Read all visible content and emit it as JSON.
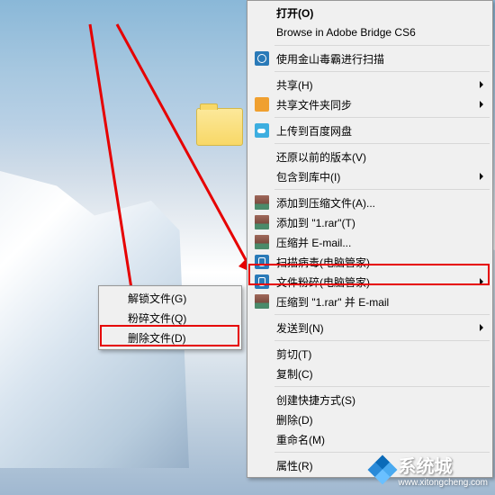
{
  "left_menu": {
    "items": [
      {
        "label": "解锁文件(G)"
      },
      {
        "label": "粉碎文件(Q)"
      },
      {
        "label": "删除文件(D)"
      }
    ]
  },
  "right_menu": {
    "groups": [
      [
        {
          "label": "打开(O)",
          "bold": true
        },
        {
          "label": "Browse in Adobe Bridge CS6"
        }
      ],
      [
        {
          "label": "使用金山毒霸进行扫描",
          "icon": "blue"
        }
      ],
      [
        {
          "label": "共享(H)",
          "arrow": true
        },
        {
          "label": "共享文件夹同步",
          "icon": "orange",
          "arrow": true
        }
      ],
      [
        {
          "label": "上传到百度网盘",
          "icon": "cloud"
        }
      ],
      [
        {
          "label": "还原以前的版本(V)"
        },
        {
          "label": "包含到库中(I)",
          "arrow": true
        }
      ],
      [
        {
          "label": "添加到压缩文件(A)...",
          "icon": "rar"
        },
        {
          "label": "添加到 \"1.rar\"(T)",
          "icon": "rar"
        },
        {
          "label": "压缩并 E-mail...",
          "icon": "rar"
        },
        {
          "label": "扫描病毒(电脑管家)",
          "icon": "tc"
        },
        {
          "label": "文件粉碎(电脑管家)",
          "icon": "tc",
          "arrow": true
        },
        {
          "label": "压缩到 \"1.rar\" 并 E-mail",
          "icon": "rar"
        }
      ],
      [
        {
          "label": "发送到(N)",
          "arrow": true
        }
      ],
      [
        {
          "label": "剪切(T)"
        },
        {
          "label": "复制(C)"
        }
      ],
      [
        {
          "label": "创建快捷方式(S)"
        },
        {
          "label": "删除(D)"
        },
        {
          "label": "重命名(M)"
        }
      ],
      [
        {
          "label": "属性(R)"
        }
      ]
    ]
  },
  "watermark": {
    "text": "系统城",
    "sub": "www.xitongcheng.com"
  }
}
